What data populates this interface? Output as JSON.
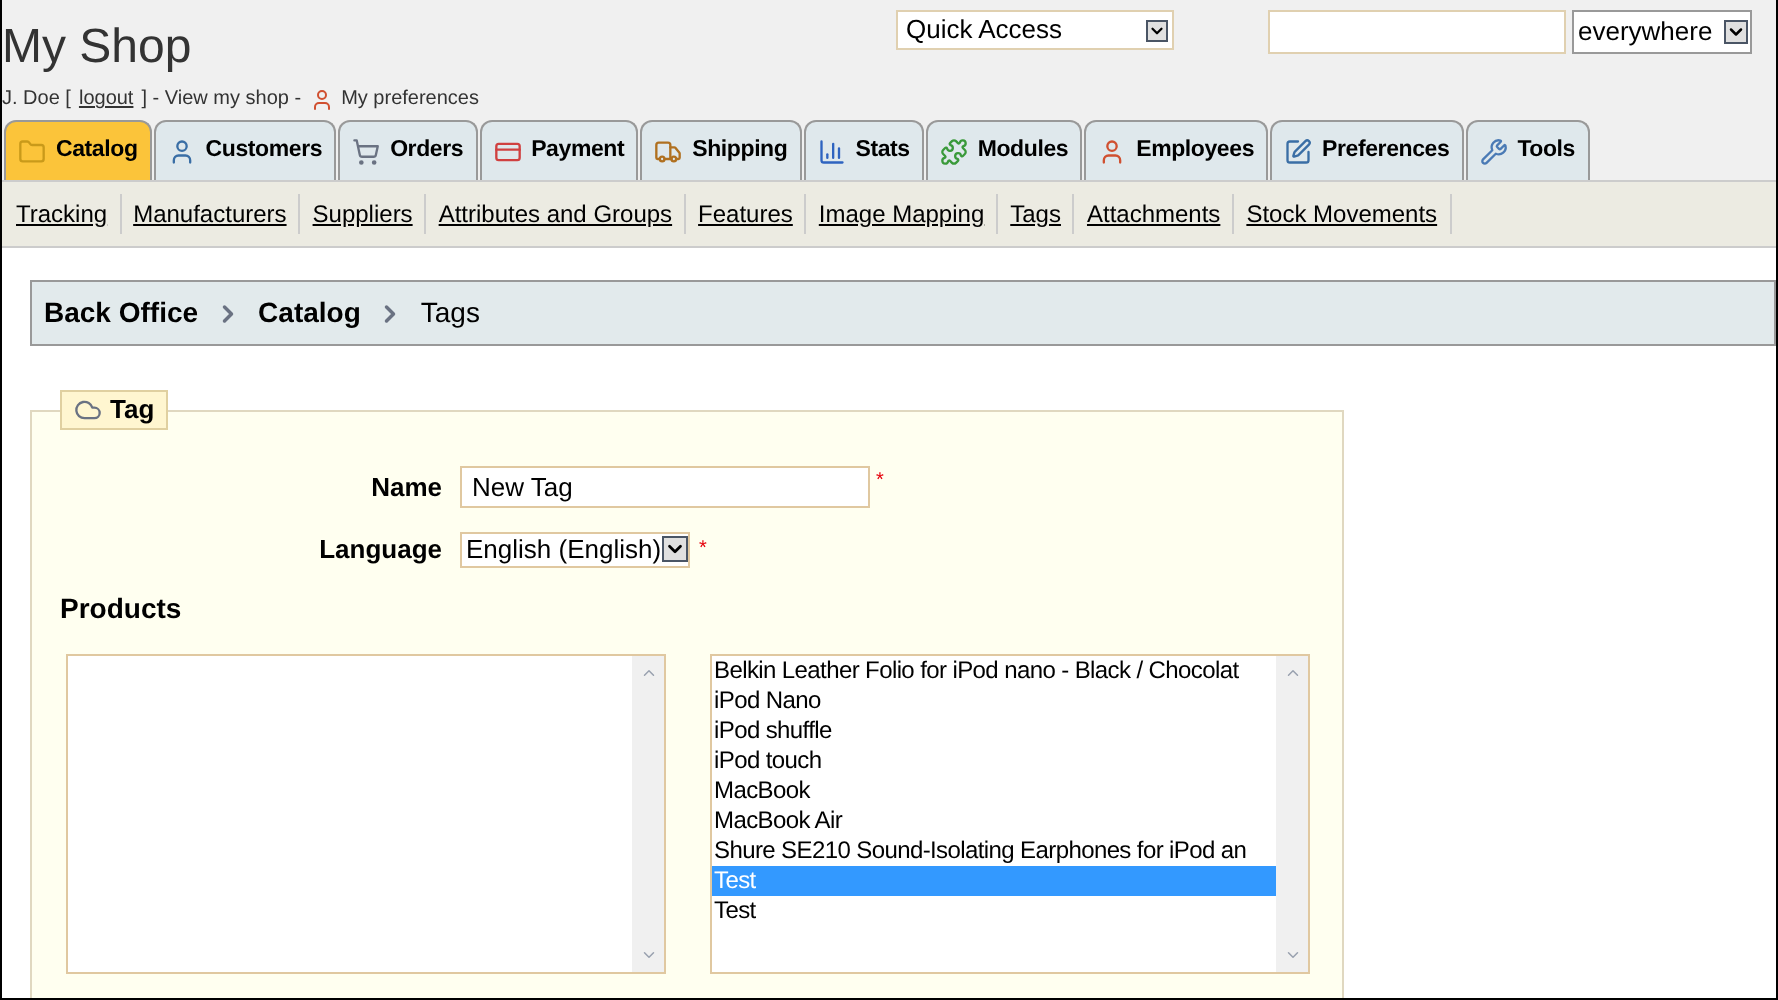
{
  "header": {
    "title": "My Shop",
    "quick_access": {
      "value": "Quick Access"
    },
    "search": {
      "scope": "everywhere"
    },
    "user_line": {
      "user": "J. Doe [",
      "logout": "logout",
      "after_logout": "] - View my shop -",
      "preferences": "My preferences"
    }
  },
  "tabs": [
    {
      "label": "Catalog",
      "selected": true
    },
    {
      "label": "Customers",
      "selected": false
    },
    {
      "label": "Orders",
      "selected": false
    },
    {
      "label": "Payment",
      "selected": false
    },
    {
      "label": "Shipping",
      "selected": false
    },
    {
      "label": "Stats",
      "selected": false
    },
    {
      "label": "Modules",
      "selected": false
    },
    {
      "label": "Employees",
      "selected": false
    },
    {
      "label": "Preferences",
      "selected": false
    },
    {
      "label": "Tools",
      "selected": false
    }
  ],
  "subnav": [
    "Tracking",
    "Manufacturers",
    "Suppliers",
    "Attributes and Groups",
    "Features",
    "Image Mapping",
    "Tags",
    "Attachments",
    "Stock Movements"
  ],
  "breadcrumb": [
    "Back Office",
    "Catalog",
    "Tags"
  ],
  "form": {
    "legend": "Tag",
    "name_label": "Name",
    "name_value": "New Tag",
    "required": "*",
    "language_label": "Language",
    "language_value": "English (English)",
    "products_label": "Products",
    "available": [
      {
        "label": "Belkin Leather Folio for iPod nano - Black / Chocolat",
        "selected": false
      },
      {
        "label": "iPod Nano",
        "selected": false
      },
      {
        "label": "iPod shuffle",
        "selected": false
      },
      {
        "label": "iPod touch",
        "selected": false
      },
      {
        "label": "MacBook",
        "selected": false
      },
      {
        "label": "MacBook Air",
        "selected": false
      },
      {
        "label": "Shure SE210 Sound-Isolating Earphones for iPod an",
        "selected": false
      },
      {
        "label": "Test",
        "selected": true
      },
      {
        "label": "Test",
        "selected": false
      }
    ]
  }
}
